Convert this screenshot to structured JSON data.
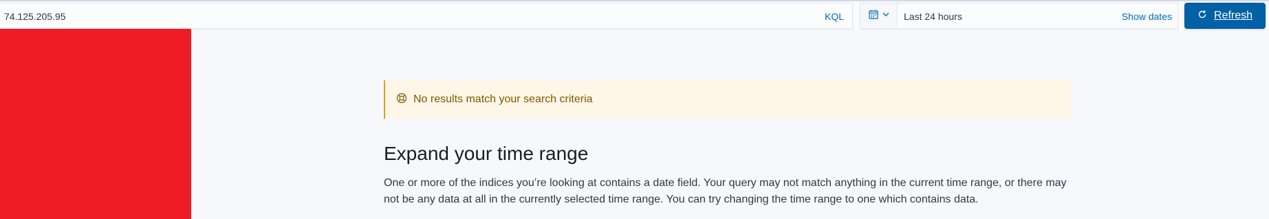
{
  "search": {
    "query_value": "74.125.205.95",
    "language_label": "KQL"
  },
  "date_picker": {
    "quick_icon": "calendar-icon",
    "chevron_icon": "chevron-down-icon",
    "range_label": "Last 24 hours",
    "show_dates_label": "Show dates"
  },
  "refresh": {
    "icon": "refresh-icon",
    "label": "Refresh"
  },
  "callout": {
    "icon": "help-icon",
    "text": "No results match your search criteria"
  },
  "main": {
    "heading": "Expand your time range",
    "description": "One or more of the indices you’re looking at contains a date field. Your query may not match anything in the current time range, or there may not be any data at all in the currently selected time range. You can try changing the time range to one which contains data."
  },
  "colors": {
    "sidebar": "#ee1c25",
    "primary": "#0061a6",
    "link": "#006bb8",
    "callout_bg": "#fef6e6",
    "callout_border": "#d6a21c"
  }
}
